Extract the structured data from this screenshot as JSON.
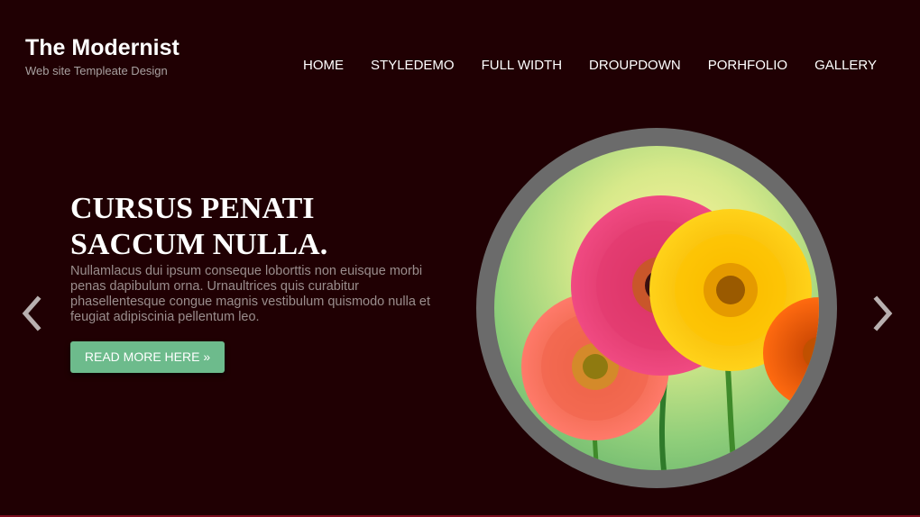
{
  "header": {
    "site_title": "The Modernist",
    "tagline": "Web site Templeate Design"
  },
  "nav": {
    "items": [
      {
        "label": "HOME"
      },
      {
        "label": "STYLEDEMO"
      },
      {
        "label": "FULL WIDTH"
      },
      {
        "label": "DROUPDOWN"
      },
      {
        "label": "PORHFOLIO"
      },
      {
        "label": "GALLERY"
      }
    ]
  },
  "slide": {
    "heading_line1": "CURSUS PENATI",
    "heading_line2": "SACCUM NULLA.",
    "body": "Nullamlacus dui ipsum conseque loborttis non euisque morbi penas dapibulum orna. Urnaultrices quis curabitur phasellentesque congue magnis vestibulum quismodo nulla et feugiat adipiscinia pellentum leo.",
    "button_label": "READ MORE HERE »",
    "image_subject": "gerbera-daisies-photo"
  },
  "slider_controls": {
    "prev_icon": "chevron-left-icon",
    "next_icon": "chevron-right-icon"
  },
  "colors": {
    "background": "#200003",
    "button": "#6dbb8c",
    "ring": "#6b6b6b",
    "body_text": "#9a8d8d"
  }
}
